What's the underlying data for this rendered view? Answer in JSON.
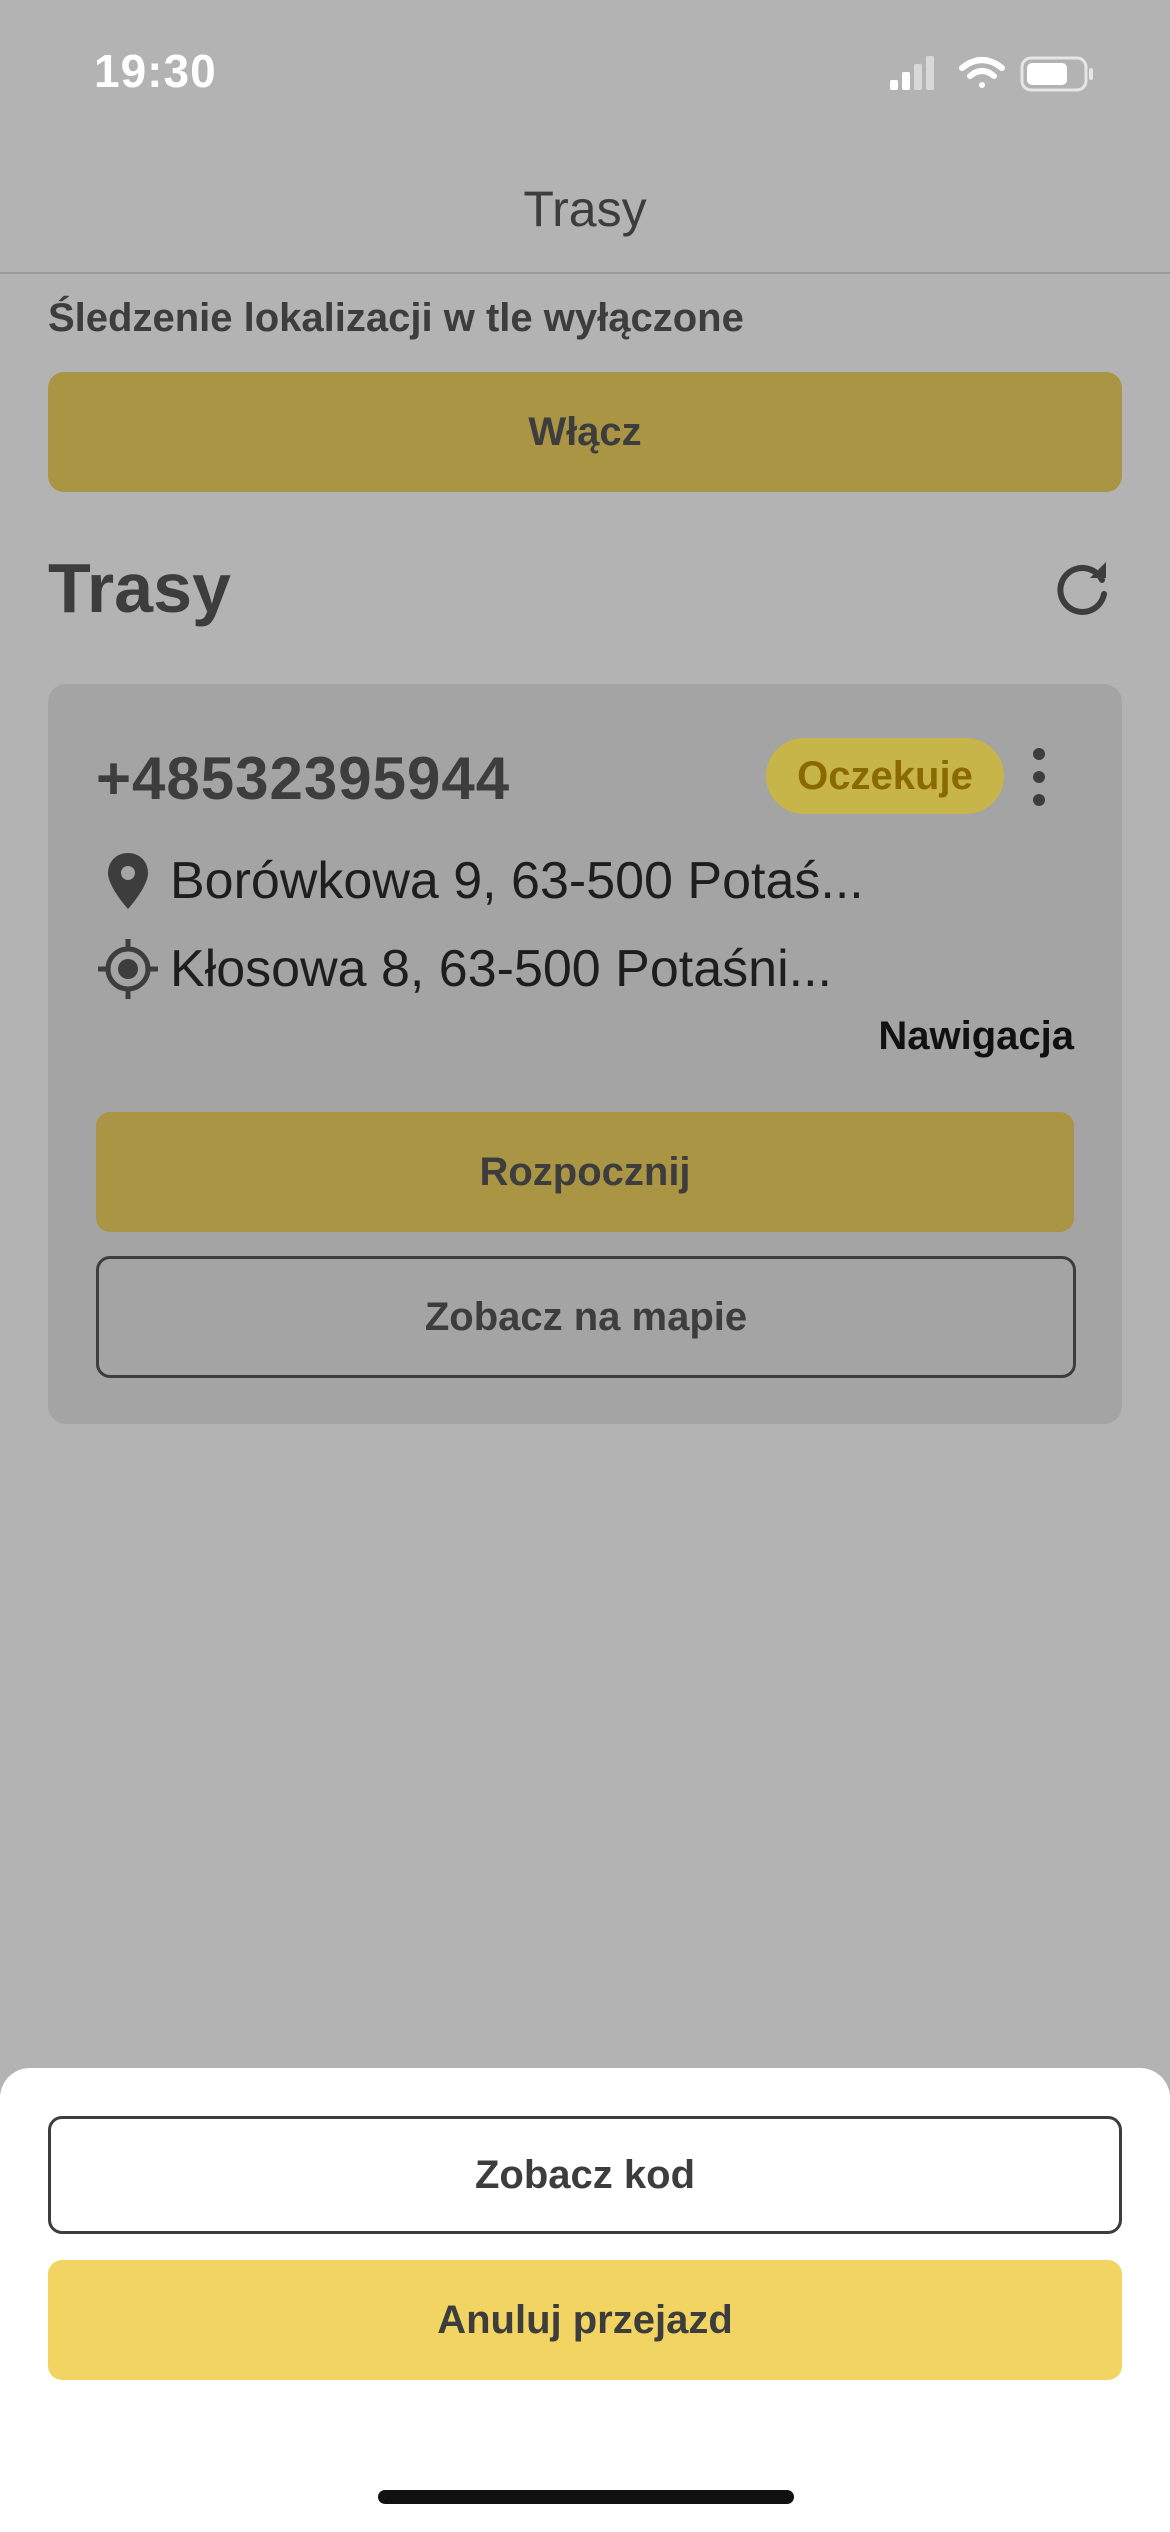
{
  "status_bar": {
    "time": "19:30"
  },
  "nav": {
    "title": "Trasy"
  },
  "tracking": {
    "message": "Śledzenie lokalizacji w tle wyłączone",
    "enable_label": "Włącz"
  },
  "section": {
    "title": "Trasy"
  },
  "route_card": {
    "phone": "+48532395944",
    "status": "Oczekuje",
    "pickup_address": "Borówkowa 9, 63-500 Potaś...",
    "destination_address": "Kłosowa 8, 63-500 Potaśni...",
    "navigation_label": "Nawigacja",
    "start_label": "Rozpocznij",
    "map_label": "Zobacz na mapie"
  },
  "sheet": {
    "view_code_label": "Zobacz kod",
    "cancel_label": "Anuluj przejazd"
  },
  "colors": {
    "accent": "#f2d462",
    "accent_dimmed": "#aa9545",
    "overlay": "#b3b3b3",
    "text": "#3d3d3d"
  }
}
